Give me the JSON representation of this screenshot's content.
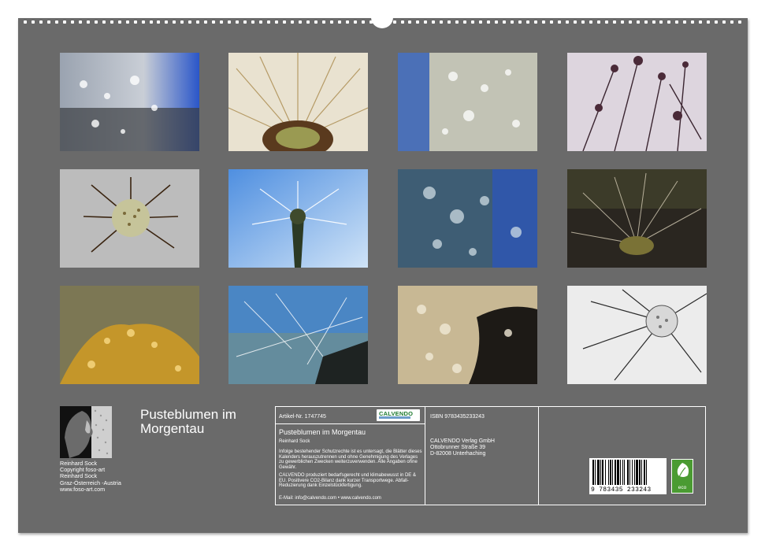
{
  "author_block": {
    "name": "Reinhard Sock",
    "copyright": "Copyright foso-art",
    "name2": "Reinhard Sock",
    "location": "Graz-Österreich -Austria",
    "website": "www.foso-art.com"
  },
  "calendar_title": "Pusteblumen im Morgentau",
  "card": {
    "article_no": "Artikel-Nr. 1747745",
    "logo_text": "CALVENDO",
    "title": "Pusteblumen im Morgentau",
    "author": "Reinhard Sock",
    "legal_text": "Infolge bestehender Schutzrechte ist es untersagt, die Blätter dieses Kalenders herauszutrennen und ohne Genehmigung des Verlages zu gewerblichen Zwecken weiterzuverwenden. Alle Angaben ohne Gewähr.",
    "production_text": "CALVENDO produziert bedarfsgerecht und klimabewusst in DE & EU. Positivere CO2-Bilanz dank kurzer Transportwege. Abfall-Reduzierung dank Einzelstückfertigung.",
    "contact": "E-Mail: info@calvendo.com • www.calvendo.com",
    "isbn": "ISBN 9783435233243",
    "publisher": "CALVENDO Verlag GmbH",
    "street": "Ottobrunner Straße 39",
    "city": "D-82008 Unterhaching",
    "barcode_digits": "9 783435 233243",
    "eco_label": "eco"
  },
  "colors": {
    "sheet": "#6a6a6a",
    "text": "#ffffff",
    "eco_green": "#4a9b32",
    "calvendo_green": "#1e7a2f"
  }
}
